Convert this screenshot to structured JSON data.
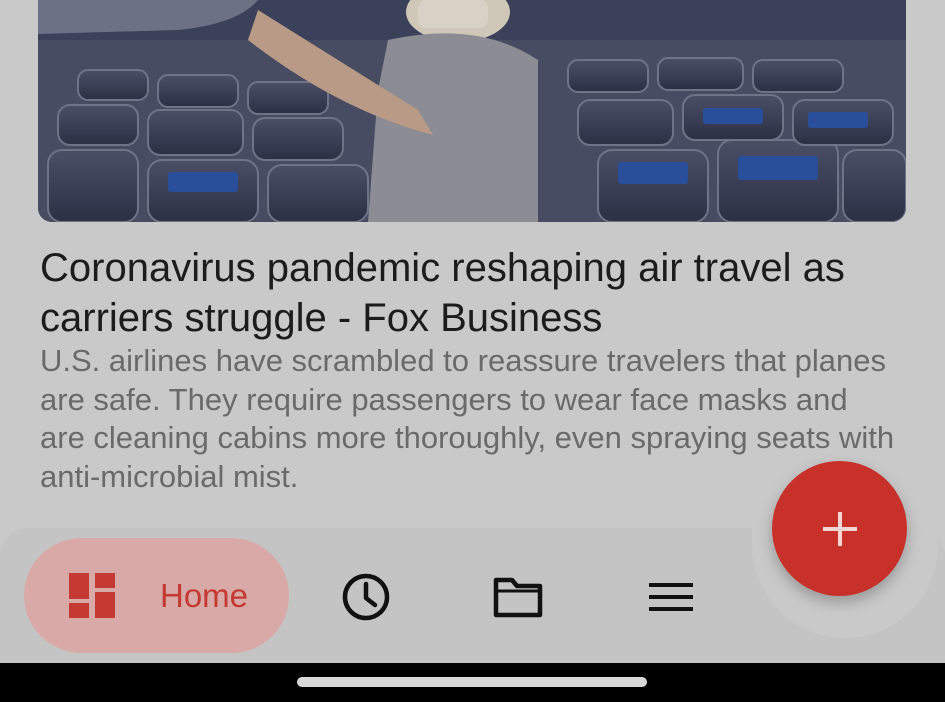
{
  "article": {
    "headline": "Coronavirus pandemic reshaping air travel as carriers struggle - Fox Business",
    "summary": "U.S. airlines have scrambled to reassure travelers that planes are safe. They require passengers to wear face masks and are cleaning cabins more thoroughly, even spraying seats with anti-microbial mist."
  },
  "nav": {
    "home_label": "Home",
    "items": [
      {
        "icon": "dashboard-icon",
        "label": "Home",
        "selected": true
      },
      {
        "icon": "clock-icon"
      },
      {
        "icon": "folder-icon"
      },
      {
        "icon": "hamburger-menu-icon"
      }
    ]
  },
  "fab": {
    "icon": "plus-icon"
  },
  "colors": {
    "accent": "#c7312a",
    "home_pill": "#d8a9a7",
    "nav_bg": "#c4c4c4",
    "page_bg": "#c9c9c9"
  }
}
